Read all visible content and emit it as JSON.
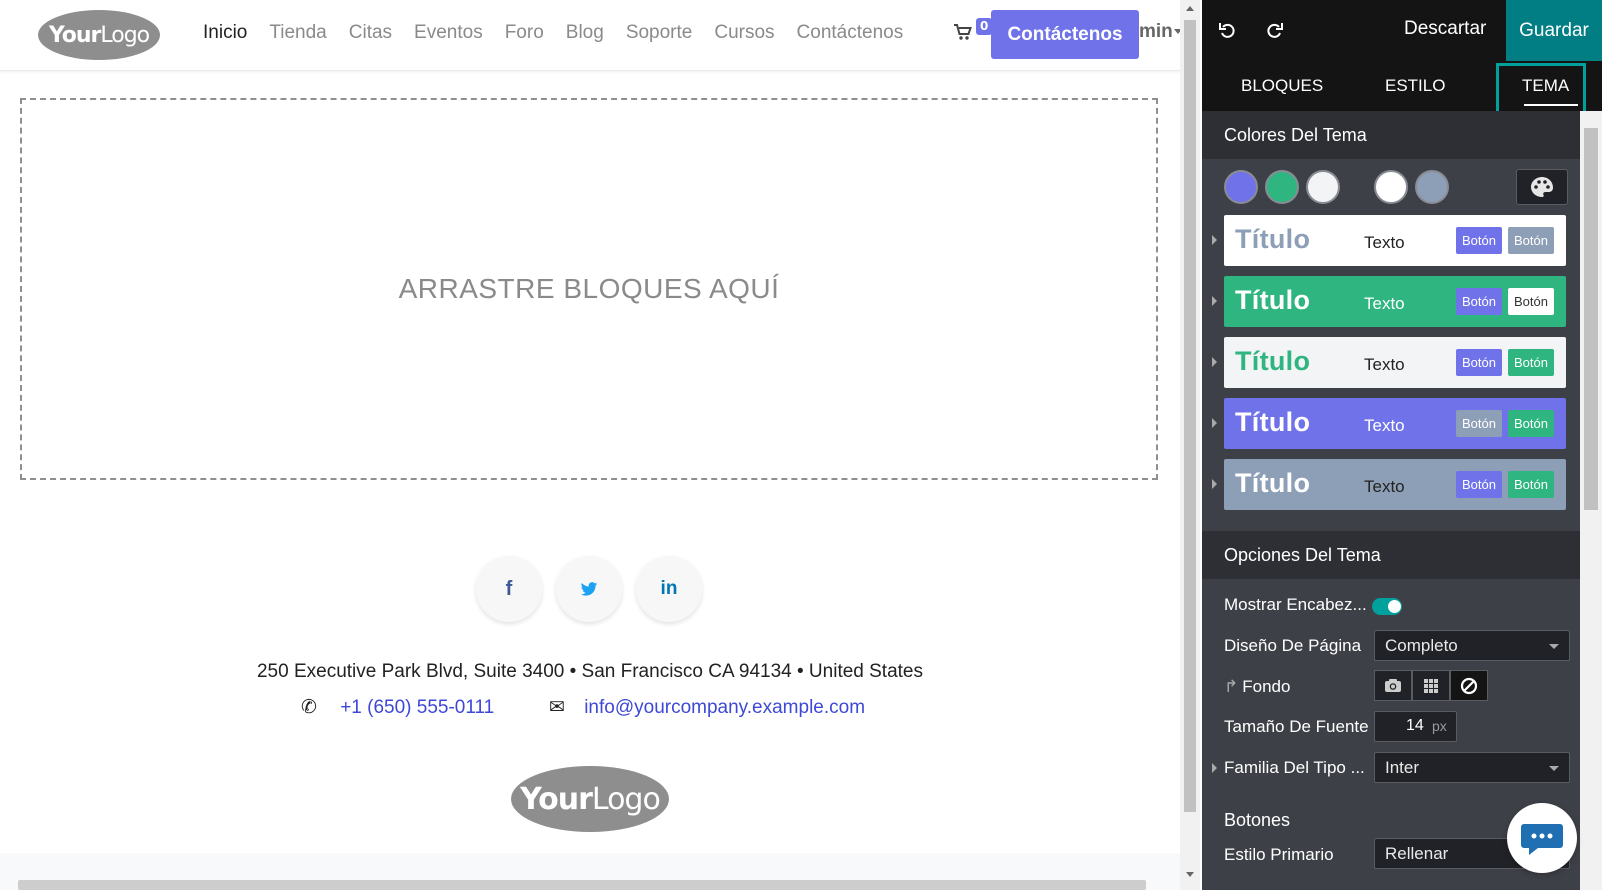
{
  "site": {
    "logo": {
      "bold": "Your",
      "light": "Logo"
    },
    "nav": {
      "items": [
        {
          "label": "Inicio",
          "active": true
        },
        {
          "label": "Tienda",
          "active": false
        },
        {
          "label": "Citas",
          "active": false
        },
        {
          "label": "Eventos",
          "active": false
        },
        {
          "label": "Foro",
          "active": false
        },
        {
          "label": "Blog",
          "active": false
        },
        {
          "label": "Soporte",
          "active": false
        },
        {
          "label": "Cursos",
          "active": false
        },
        {
          "label": "Contáctenos",
          "active": false
        }
      ],
      "cart_count": "0",
      "cta_label": "Contáctenos",
      "user_label": "min"
    },
    "dropzone_text": "ARRASTRE BLOQUES AQUÍ",
    "social": [
      "facebook-icon",
      "twitter-icon",
      "linkedin-icon"
    ],
    "footer": {
      "address": "250 Executive Park Blvd, Suite 3400 • San Francisco CA 94134 • United States",
      "phone": "+1 (650) 555-0111",
      "email": "info@yourcompany.example.com",
      "logo": {
        "bold": "Your",
        "light": "Logo"
      }
    }
  },
  "editor": {
    "toolbar": {
      "undo_icon": "undo-icon",
      "redo_icon": "redo-icon",
      "discard_label": "Descartar",
      "save_label": "Guardar"
    },
    "tabs": [
      {
        "label": "BLOQUES",
        "active": false
      },
      {
        "label": "ESTILO",
        "active": false
      },
      {
        "label": "TEMA",
        "active": true
      }
    ],
    "theme_colors": {
      "heading": "Colores Del Tema",
      "swatches": [
        "#6f72e8",
        "#2fb57f",
        "#f3f4f6",
        "#ffffff",
        "#8d9fb6"
      ],
      "palette_icon": "palette-icon"
    },
    "presets": [
      {
        "title": "Título",
        "text": "Texto",
        "btn1": "Botón",
        "btn2": "Botón",
        "bg": "#ffffff",
        "title_color": "#8d9fb6",
        "text_color": "#222222",
        "btn1_bg": "#6f72e8",
        "btn1_fg": "#ffffff",
        "btn2_bg": "#8d9fb6",
        "btn2_fg": "#ffffff"
      },
      {
        "title": "Título",
        "text": "Texto",
        "btn1": "Botón",
        "btn2": "Botón",
        "bg": "#2fb57f",
        "title_color": "#ffffff",
        "text_color": "#ffffff",
        "btn1_bg": "#6f72e8",
        "btn1_fg": "#ffffff",
        "btn2_bg": "#ffffff",
        "btn2_fg": "#333333"
      },
      {
        "title": "Título",
        "text": "Texto",
        "btn1": "Botón",
        "btn2": "Botón",
        "bg": "#f3f4f6",
        "title_color": "#2fb57f",
        "text_color": "#222222",
        "btn1_bg": "#6f72e8",
        "btn1_fg": "#ffffff",
        "btn2_bg": "#2fb57f",
        "btn2_fg": "#ffffff"
      },
      {
        "title": "Título",
        "text": "Texto",
        "btn1": "Botón",
        "btn2": "Botón",
        "bg": "#6f72e8",
        "title_color": "#ffffff",
        "text_color": "#ffffff",
        "btn1_bg": "#8d9fb6",
        "btn1_fg": "#ffffff",
        "btn2_bg": "#2fb57f",
        "btn2_fg": "#ffffff"
      },
      {
        "title": "Título",
        "text": "Texto",
        "btn1": "Botón",
        "btn2": "Botón",
        "bg": "#8d9fb6",
        "title_color": "#ffffff",
        "text_color": "#222222",
        "btn1_bg": "#6f72e8",
        "btn1_fg": "#ffffff",
        "btn2_bg": "#2fb57f",
        "btn2_fg": "#ffffff"
      }
    ],
    "theme_options": {
      "heading": "Opciones Del Tema",
      "show_header_label": "Mostrar Encabez...",
      "show_header_on": true,
      "page_layout_label": "Diseño De Página",
      "page_layout_value": "Completo",
      "background_label": "Fondo",
      "background_icons": [
        "camera-icon",
        "grid-icon",
        "none-icon"
      ],
      "font_size_label": "Tamaño De Fuente",
      "font_size_value": "14",
      "font_size_unit": "px",
      "font_family_label": "Familia Del Tipo ...",
      "font_family_value": "Inter"
    },
    "buttons": {
      "heading": "Botones",
      "primary_style_label": "Estilo Primario",
      "primary_style_value": "Rellenar"
    },
    "chat_icon": "chat-icon"
  }
}
